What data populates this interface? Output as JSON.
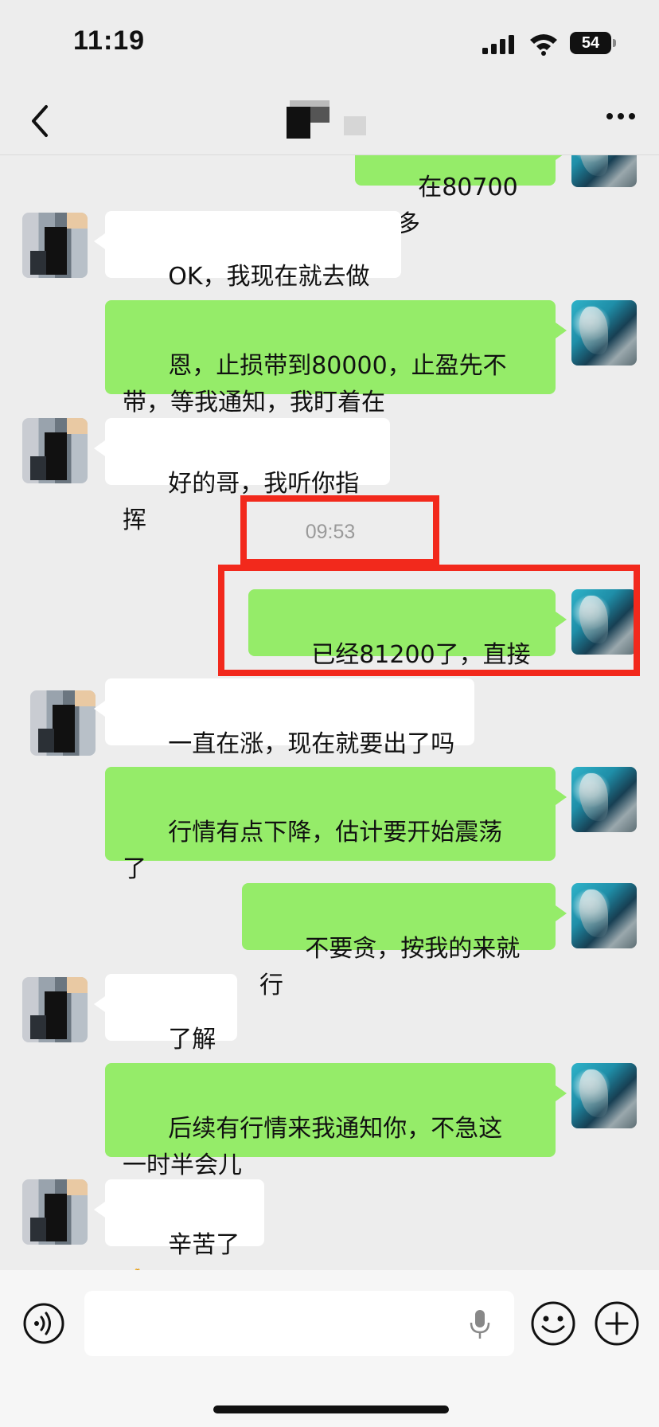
{
  "status_bar": {
    "time": "11:19",
    "battery": "54"
  },
  "header": {
    "back_icon": "chevron-left-icon",
    "more_icon": "ellipsis-icon"
  },
  "messages": [
    {
      "side": "self",
      "text": "在80700做多"
    },
    {
      "side": "peer",
      "text": "OK，我现在就去做多"
    },
    {
      "side": "self",
      "text": "恩，止损带到80000，止盈先不\n带，等我通知，我盯着在"
    },
    {
      "side": "peer",
      "text": "好的哥，我听你指挥"
    },
    {
      "side": "self",
      "text": "已经81200了，直接出"
    },
    {
      "side": "peer",
      "text": "一直在涨，现在就要出了吗"
    },
    {
      "side": "self",
      "text": "行情有点下降，估计要开始震荡\n了"
    },
    {
      "side": "self",
      "text": "不要贪，按我的来就行"
    },
    {
      "side": "peer",
      "text": "了解",
      "emoji": "👈"
    },
    {
      "side": "self",
      "text": "后续有行情来我通知你，不急这\n一时半会儿"
    },
    {
      "side": "peer",
      "text": "辛苦了",
      "emoji": "🙏"
    }
  ],
  "timestamp": "09:53",
  "input_bar": {
    "voice_icon": "voice-icon",
    "mic_icon": "microphone-icon",
    "emoji_icon": "smiley-icon",
    "plus_icon": "plus-icon"
  },
  "colors": {
    "self_bubble": "#95ec69",
    "peer_bubble": "#ffffff",
    "highlight": "#f2291c",
    "background": "#ededed"
  }
}
